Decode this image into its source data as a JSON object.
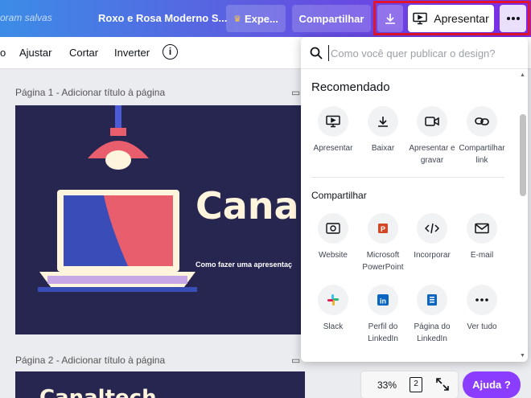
{
  "topbar": {
    "saved_text": "oram salvas",
    "doc_title": "Roxo e Rosa Moderno S...",
    "expe_label": "Expe...",
    "share_label": "Compartilhar",
    "present_label": "Apresentar"
  },
  "toolbar": {
    "items": [
      "o",
      "Ajustar",
      "Cortar",
      "Inverter"
    ],
    "info_label": "i"
  },
  "canvas": {
    "page1_label": "Página 1 - Adicionar título à página",
    "page2_label": "Página 2 - Adicionar título à página",
    "slide1_title": "Cana",
    "slide1_subtitle": "Como fazer uma apresentaç",
    "slide2_title": "Canaltech"
  },
  "panel": {
    "search_placeholder": "Como você quer publicar o design?",
    "recommended_title": "Recomendado",
    "recommended": [
      {
        "label": "Apresentar",
        "icon": "present-icon"
      },
      {
        "label": "Baixar",
        "icon": "download-icon"
      },
      {
        "label": "Apresentar e gravar",
        "icon": "camera-icon"
      },
      {
        "label": "Compartilhar link",
        "icon": "link-icon"
      }
    ],
    "share_title": "Compartilhar",
    "share": [
      {
        "label": "Website",
        "icon": "website-icon"
      },
      {
        "label": "Microsoft PowerPoint",
        "icon": "powerpoint-icon"
      },
      {
        "label": "Incorporar",
        "icon": "embed-icon"
      },
      {
        "label": "E-mail",
        "icon": "email-icon"
      },
      {
        "label": "Slack",
        "icon": "slack-icon"
      },
      {
        "label": "Perfil do LinkedIn",
        "icon": "linkedin-icon"
      },
      {
        "label": "Página do LinkedIn",
        "icon": "linkedin-page-icon"
      },
      {
        "label": "Ver tudo",
        "icon": "more-icon"
      }
    ]
  },
  "bottom": {
    "zoom": "33%",
    "pages_count": "2",
    "help_label": "Ajuda ?"
  },
  "colors": {
    "accent": "#7d2ae8",
    "help": "#8b3dff",
    "highlight_border": "#e2132a",
    "slide_bg": "#272650"
  }
}
